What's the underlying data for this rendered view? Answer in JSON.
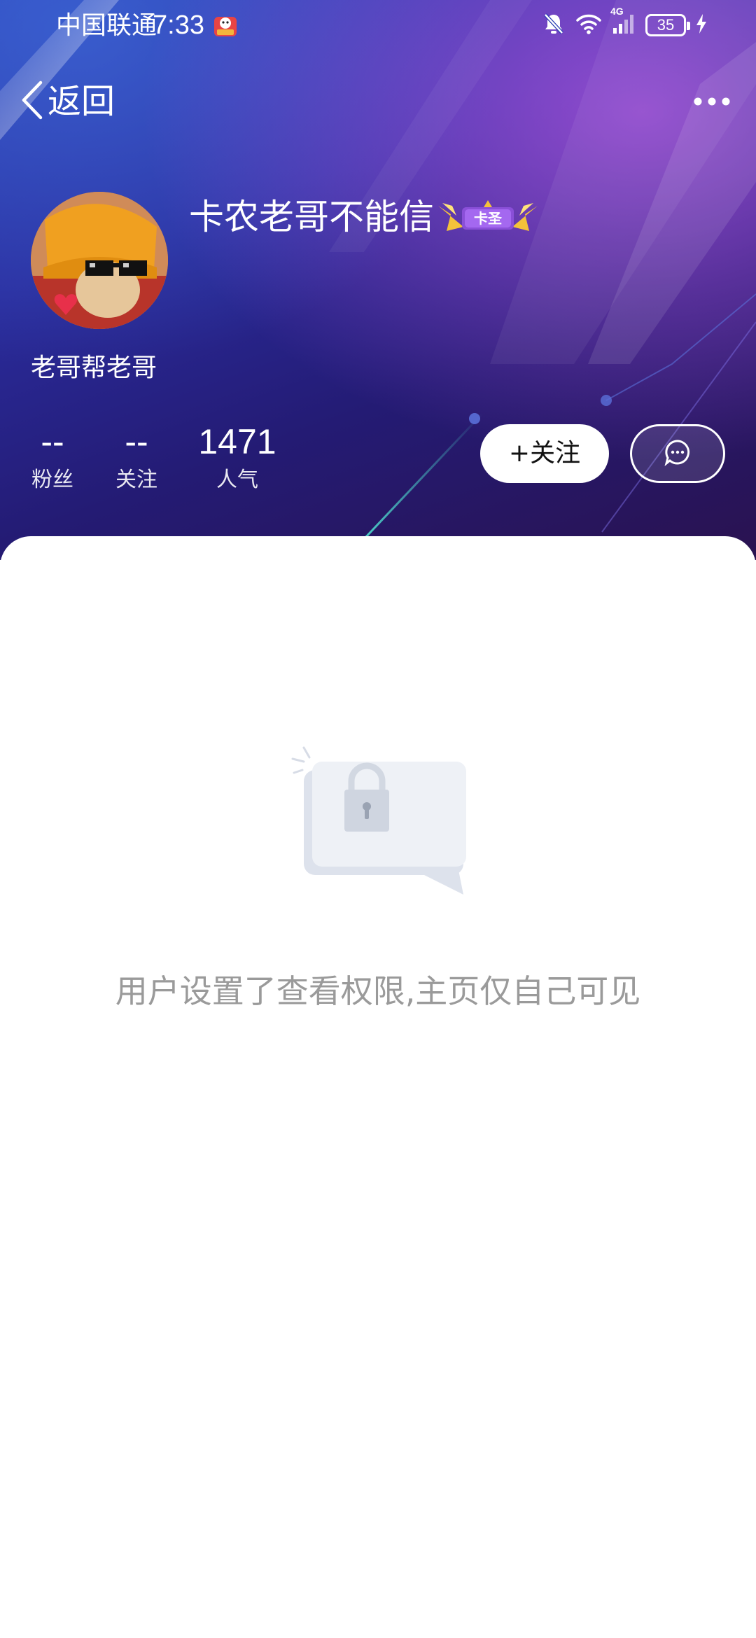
{
  "status_bar": {
    "carrier": "中国联通",
    "time": "7:33",
    "network": "4G",
    "battery": "35"
  },
  "nav": {
    "back_label": "返回"
  },
  "profile": {
    "username": "卡农老哥不能信",
    "level_badge": "卡圣",
    "bio": "老哥帮老哥"
  },
  "stats": [
    {
      "value": "--",
      "label": "粉丝"
    },
    {
      "value": "--",
      "label": "关注"
    },
    {
      "value": "1471",
      "label": "人气"
    }
  ],
  "actions": {
    "follow_label": "+关注"
  },
  "content": {
    "privacy_message": "用户设置了查看权限,主页仅自己可见"
  },
  "colors": {
    "header_gradient": [
      "#2a3fb4",
      "#241b74",
      "#2a1250"
    ],
    "accent_purple": "#be5ae6",
    "muted_text": "#9a9a9a"
  },
  "icons": {
    "back": "chevron-left-icon",
    "more": "more-dots-icon",
    "message": "chat-bubble-icon",
    "lock": "lock-icon",
    "mute": "bell-off-icon",
    "wifi": "wifi-icon",
    "signal": "signal-icon",
    "charging": "lightning-icon"
  }
}
